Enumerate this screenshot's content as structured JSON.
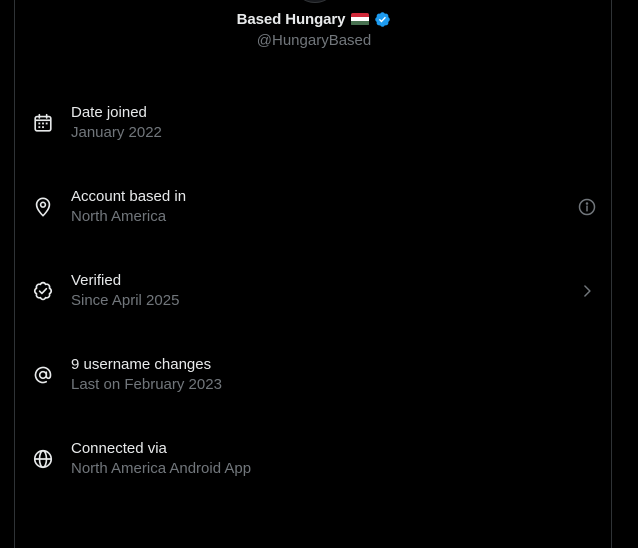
{
  "profile": {
    "display_name": "Based Hungary",
    "handle": "@HungaryBased",
    "flag_icon": "hungary-flag",
    "verified_icon": "verified-badge-icon"
  },
  "colors": {
    "background": "#000000",
    "primary_text": "#e7e9ea",
    "secondary_text": "#71767b",
    "verified_blue": "#1d9bf0",
    "flag_red": "#ce2939",
    "flag_white": "#ffffff",
    "flag_green": "#477050"
  },
  "rows": [
    {
      "icon": "calendar-icon",
      "title": "Date joined",
      "subtitle": "January 2022",
      "action": null
    },
    {
      "icon": "location-pin-icon",
      "title": "Account based in",
      "subtitle": "North America",
      "action": "info-icon"
    },
    {
      "icon": "verified-outline-icon",
      "title": "Verified",
      "subtitle": "Since April 2025",
      "action": "chevron-right-icon"
    },
    {
      "icon": "at-sign-icon",
      "title": "9 username changes",
      "subtitle": "Last on February 2023",
      "action": null
    },
    {
      "icon": "globe-icon",
      "title": "Connected via",
      "subtitle": "North America Android App",
      "action": null
    }
  ]
}
